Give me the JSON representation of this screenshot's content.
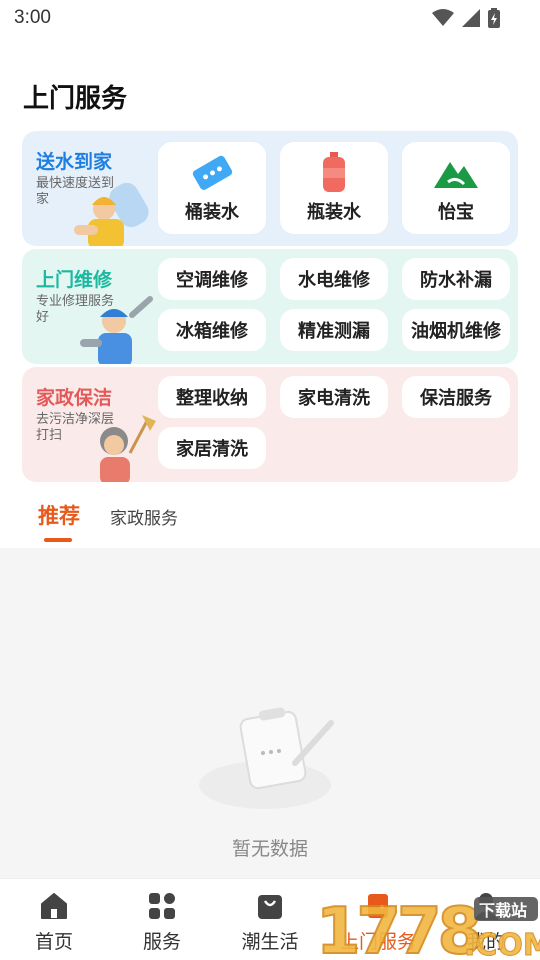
{
  "status_bar": {
    "time": "3:00"
  },
  "page_title": "上门服务",
  "categories": {
    "water": {
      "title": "送水到家",
      "subtitle": "最快速度送到家",
      "title_color": "#1f7fe0",
      "items": [
        {
          "label": "桶装水",
          "icon": "water-ticket-icon"
        },
        {
          "label": "瓶装水",
          "icon": "water-bottle-icon"
        },
        {
          "label": "怡宝",
          "icon": "mountain-logo-icon"
        }
      ]
    },
    "repair": {
      "title": "上门维修",
      "subtitle": "专业修理服务好",
      "title_color": "#1bb9a0",
      "items": [
        {
          "label": "空调维修"
        },
        {
          "label": "水电维修"
        },
        {
          "label": "防水补漏"
        },
        {
          "label": "冰箱维修"
        },
        {
          "label": "精准测漏"
        },
        {
          "label": "油烟机维修"
        }
      ]
    },
    "housekeeping": {
      "title": "家政保洁",
      "subtitle": "去污洁净深层打扫",
      "title_color": "#e45a5a",
      "items": [
        {
          "label": "整理收纳"
        },
        {
          "label": "家电清洗"
        },
        {
          "label": "保洁服务"
        },
        {
          "label": "家居清洗"
        }
      ]
    }
  },
  "tabs": [
    {
      "label": "推荐",
      "active": true
    },
    {
      "label": "家政服务",
      "active": false
    }
  ],
  "empty_state": {
    "text": "暂无数据"
  },
  "bottom_nav": [
    {
      "label": "首页",
      "icon": "home-icon"
    },
    {
      "label": "服务",
      "icon": "grid-icon"
    },
    {
      "label": "潮生活",
      "icon": "shopping-bag-icon"
    },
    {
      "label": "上门服务",
      "icon": "door-service-icon",
      "active": true
    },
    {
      "label": "我的",
      "icon": "person-icon"
    }
  ],
  "watermark": {
    "text": "1778",
    "domain": ".COM",
    "badge": "下载站"
  },
  "colors": {
    "accent": "#e85a1c",
    "water_bg": "#e6f0fb",
    "repair_bg": "#e4f6f1",
    "house_bg": "#fbeaea"
  }
}
